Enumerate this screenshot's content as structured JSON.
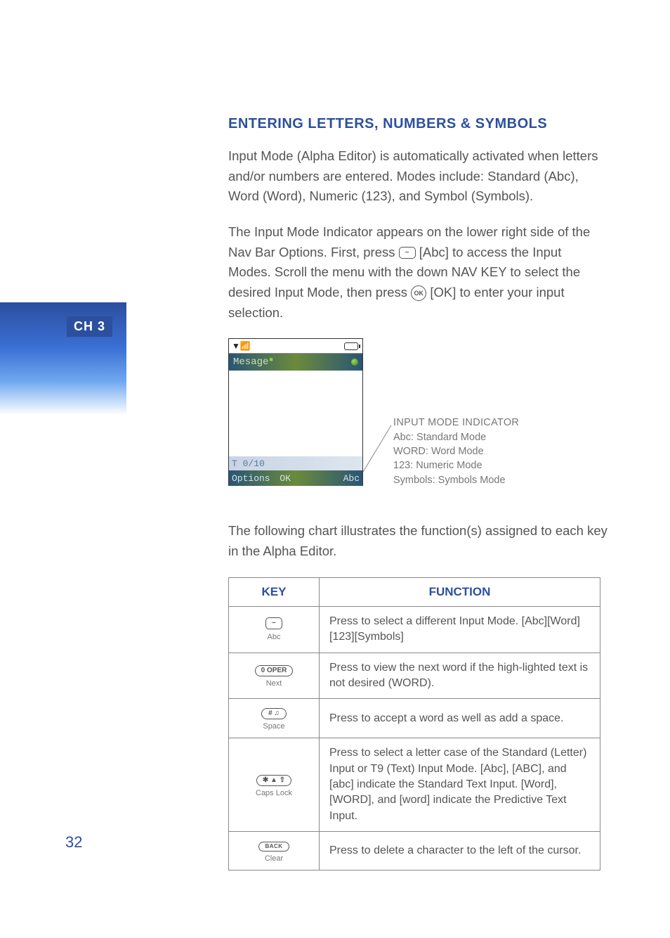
{
  "chapter_label": "CH 3",
  "page_number": "32",
  "section_title": "ENTERING LETTERS, NUMBERS & SYMBOLS",
  "para1": "Input Mode (Alpha Editor) is automatically activated when letters and/or numbers are entered. Modes include: Standard (Abc), Word (Word), Numeric (123), and Symbol (Symbols).",
  "para2a": "The Input Mode Indicator appears on the lower right side of the Nav Bar Options. First, press ",
  "para2a_key": "–",
  "para2b": " [Abc] to access the Input Modes. Scroll the menu with the down NAV KEY to select the desired Input Mode, then press ",
  "para2b_key": "OK",
  "para2c": " [OK] to enter your input selection.",
  "phone": {
    "title": "Mesage",
    "counter": "T 0/10",
    "options": "Options",
    "ok": "OK",
    "mode": "Abc"
  },
  "callout": {
    "head": "INPUT MODE INDICATOR",
    "l1": "Abc: Standard Mode",
    "l2": "WORD: Word Mode",
    "l3": "123: Numeric Mode",
    "l4": "Symbols: Symbols Mode"
  },
  "para3": "The following chart illustrates the function(s) assigned to each key in the Alpha Editor.",
  "table": {
    "h_key": "KEY",
    "h_func": "FUNCTION",
    "rows": [
      {
        "glyph": "–",
        "sub": "Abc",
        "func": "Press to select a different Input Mode. [Abc][Word][123][Symbols]"
      },
      {
        "glyph": "0 OPER",
        "sub": "Next",
        "func": "Press to view the next word if the high-lighted text is not desired (WORD)."
      },
      {
        "glyph": "# ♫",
        "sub": "Space",
        "func": "Press to accept a word as well as add a space."
      },
      {
        "glyph": "✱ ▲ ⇧",
        "sub": "Caps Lock",
        "func": "Press to select a letter case of the Standard (Letter) Input or T9 (Text) Input Mode. [Abc], [ABC], and [abc] indicate the Standard Text Input. [Word], [WORD], and [word] indicate the Predictive Text Input."
      },
      {
        "glyph": "BACK",
        "sub": "Clear",
        "func": "Press to delete a character to the left of the cursor."
      }
    ]
  }
}
